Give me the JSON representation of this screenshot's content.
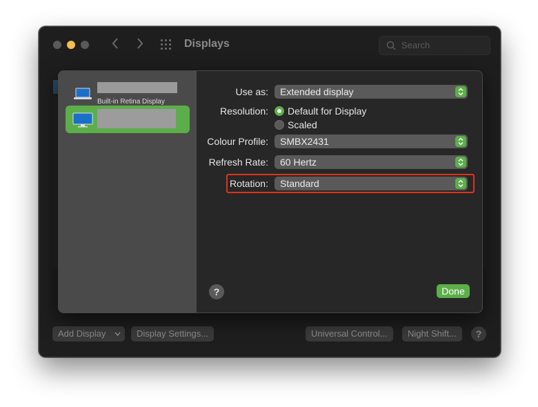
{
  "window": {
    "title": "Displays"
  },
  "search": {
    "placeholder": "Search"
  },
  "sidebar": {
    "displays": [
      {
        "subtitle": "Built-in Retina Display",
        "selected": false
      },
      {
        "subtitle": "",
        "selected": true
      }
    ]
  },
  "form": {
    "use_as_label": "Use as:",
    "use_as_value": "Extended display",
    "resolution_label": "Resolution:",
    "resolution_options": [
      "Default for Display",
      "Scaled"
    ],
    "resolution_selected": "Default for Display",
    "colour_profile_label": "Colour Profile:",
    "colour_profile_value": "SMBX2431",
    "refresh_rate_label": "Refresh Rate:",
    "refresh_rate_value": "60 Hertz",
    "rotation_label": "Rotation:",
    "rotation_value": "Standard"
  },
  "sheet": {
    "help": "?",
    "done_label": "Done"
  },
  "bottom_bar": {
    "add_display": "Add Display",
    "display_settings": "Display Settings...",
    "universal_control": "Universal Control...",
    "night_shift": "Night Shift...",
    "help": "?"
  },
  "colors": {
    "accent": "#5cae4a",
    "highlight_box": "#e0321c",
    "minimize_light": "#f5bd4f"
  }
}
